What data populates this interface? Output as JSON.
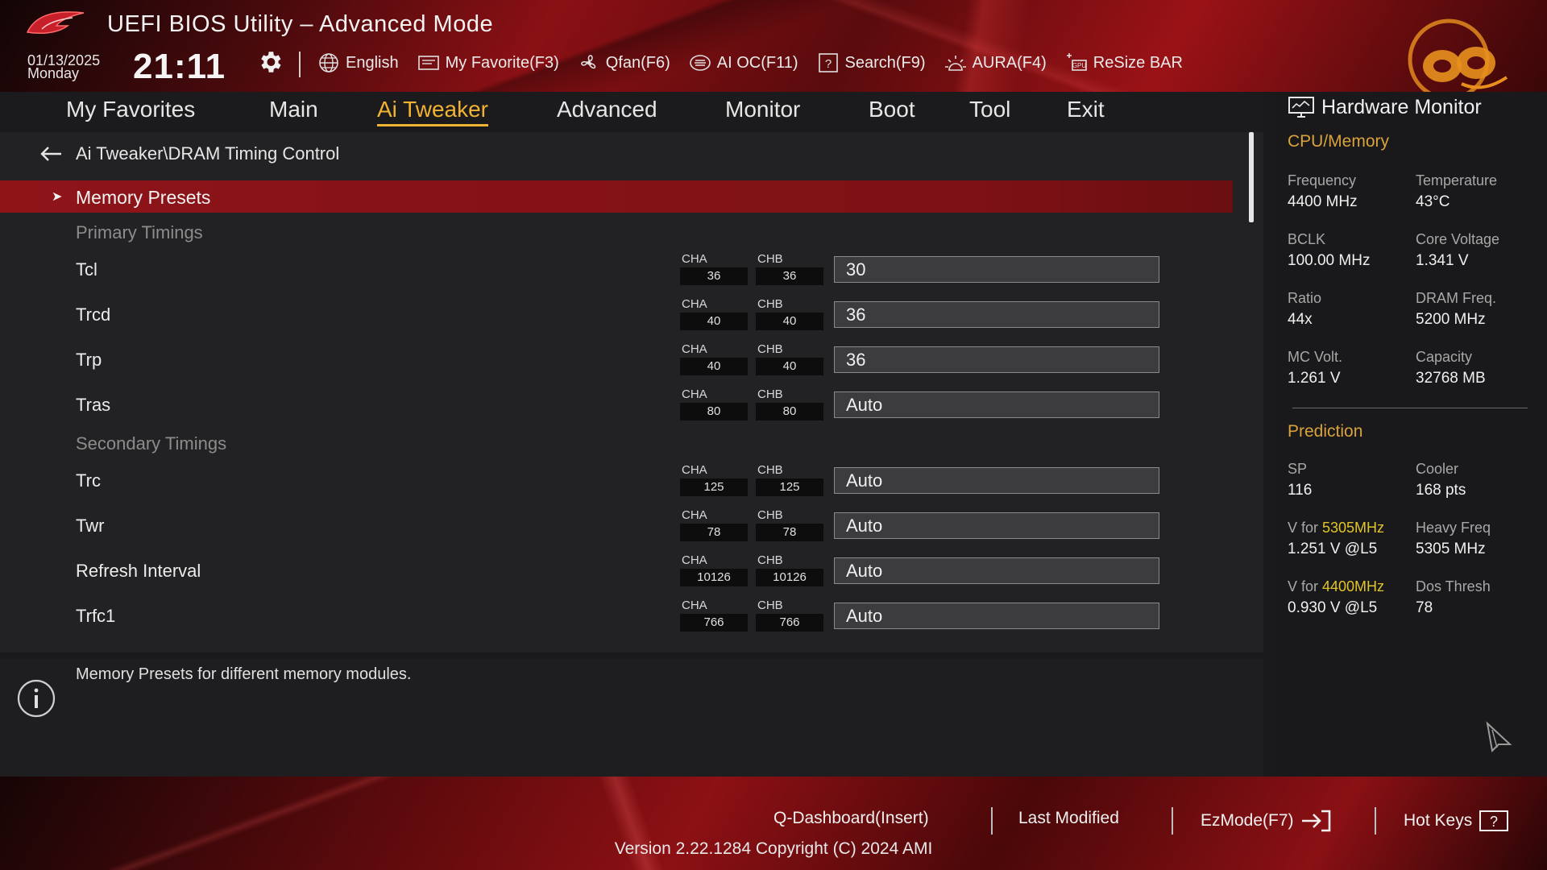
{
  "header": {
    "title": "UEFI BIOS Utility – Advanced Mode",
    "date": "01/13/2025",
    "day": "Monday",
    "time": "21:11",
    "toolbar": [
      {
        "label": "English",
        "icon": "globe-icon"
      },
      {
        "label": "My Favorite(F3)",
        "icon": "favorite-icon"
      },
      {
        "label": "Qfan(F6)",
        "icon": "fan-icon"
      },
      {
        "label": "AI OC(F11)",
        "icon": "ai-oc-icon"
      },
      {
        "label": "Search(F9)",
        "icon": "search-icon"
      },
      {
        "label": "AURA(F4)",
        "icon": "aura-icon"
      },
      {
        "label": "ReSize BAR",
        "icon": "resize-bar-icon"
      }
    ]
  },
  "nav": {
    "tabs": [
      "My Favorites",
      "Main",
      "Ai Tweaker",
      "Advanced",
      "Monitor",
      "Boot",
      "Tool",
      "Exit"
    ],
    "active": "Ai Tweaker"
  },
  "main": {
    "breadcrumb": "Ai Tweaker\\DRAM Timing Control",
    "presets_label": "Memory Presets",
    "primary_label": "Primary Timings",
    "secondary_label": "Secondary Timings",
    "channel_a": "CHA",
    "channel_b": "CHB",
    "primary": [
      {
        "name": "Tcl",
        "cha": "36",
        "chb": "36",
        "value": "30"
      },
      {
        "name": "Trcd",
        "cha": "40",
        "chb": "40",
        "value": "36"
      },
      {
        "name": "Trp",
        "cha": "40",
        "chb": "40",
        "value": "36"
      },
      {
        "name": "Tras",
        "cha": "80",
        "chb": "80",
        "value": "Auto"
      }
    ],
    "secondary": [
      {
        "name": "Trc",
        "cha": "125",
        "chb": "125",
        "value": "Auto"
      },
      {
        "name": "Twr",
        "cha": "78",
        "chb": "78",
        "value": "Auto"
      },
      {
        "name": "Refresh Interval",
        "cha": "10126",
        "chb": "10126",
        "value": "Auto"
      },
      {
        "name": "Trfc1",
        "cha": "766",
        "chb": "766",
        "value": "Auto"
      }
    ]
  },
  "info": {
    "text": "Memory Presets for different memory modules."
  },
  "sidebar": {
    "title": "Hardware Monitor",
    "cpu_section": "CPU/Memory",
    "cpu": [
      {
        "label": "Frequency",
        "value": "4400 MHz"
      },
      {
        "label": "Temperature",
        "value": "43°C"
      },
      {
        "label": "BCLK",
        "value": "100.00 MHz"
      },
      {
        "label": "Core Voltage",
        "value": "1.341 V"
      },
      {
        "label": "Ratio",
        "value": "44x"
      },
      {
        "label": "DRAM Freq.",
        "value": "5200 MHz"
      },
      {
        "label": "MC Volt.",
        "value": "1.261 V"
      },
      {
        "label": "Capacity",
        "value": "32768 MB"
      }
    ],
    "prediction_section": "Prediction",
    "prediction": {
      "sp_label": "SP",
      "sp_value": "116",
      "cooler_label": "Cooler",
      "cooler_value": "168 pts",
      "v1_prefix": "V for ",
      "v1_freq": "5305MHz",
      "v1_value": "1.251 V @L5",
      "heavy_label": "Heavy Freq",
      "heavy_value": "5305 MHz",
      "v2_prefix": "V for ",
      "v2_freq": "4400MHz",
      "v2_value": "0.930 V @L5",
      "dos_label": "Dos Thresh",
      "dos_value": "78"
    }
  },
  "footer": {
    "qdashboard": "Q-Dashboard(Insert)",
    "last_modified": "Last Modified",
    "ezmode": "EzMode(F7)",
    "hotkeys": "Hot Keys",
    "version": "Version 2.22.1284 Copyright (C) 2024 AMI"
  },
  "colors": {
    "accent": "#f2b233",
    "highlight_row": "#8e1418",
    "section_heading": "#d9a23c",
    "freq_highlight": "#e0c52a"
  }
}
